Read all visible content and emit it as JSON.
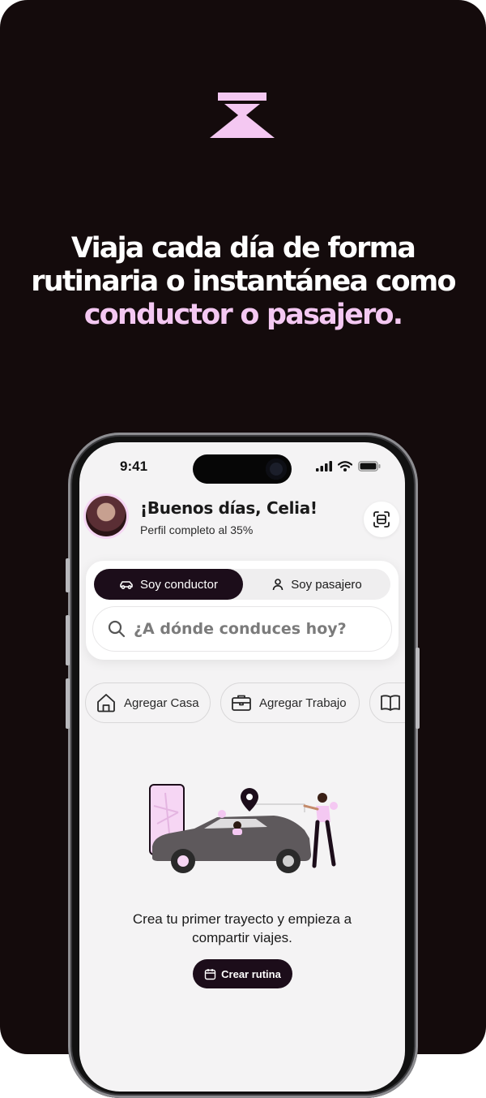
{
  "headline": {
    "line1": "Viaja cada día de forma",
    "line2": "rutinaria o instantánea como",
    "line3_highlight": "conductor o pasajero."
  },
  "status_bar": {
    "time": "9:41",
    "icons": [
      "signal-icon",
      "wifi-icon",
      "battery-icon"
    ]
  },
  "header": {
    "greeting": "¡Buenos días, Celia!",
    "profile_status": "Perfil completo al 35%"
  },
  "mode_toggle": {
    "options": [
      {
        "label": "Soy conductor",
        "icon": "car-icon",
        "selected": true
      },
      {
        "label": "Soy pasajero",
        "icon": "person-icon",
        "selected": false
      }
    ]
  },
  "search": {
    "placeholder": "¿A dónde conduces hoy?"
  },
  "quick_places": [
    {
      "label": "Agregar Casa",
      "icon": "home-icon"
    },
    {
      "label": "Agregar Trabajo",
      "icon": "briefcase-icon"
    },
    {
      "label": "",
      "icon": "book-icon"
    }
  ],
  "empty_state": {
    "message_line1": "Crea tu primer trayecto y empieza a",
    "message_line2": "compartir viajes.",
    "cta_label": "Crear rutina"
  },
  "colors": {
    "background": "#140b0c",
    "accent_pink": "#f4c8f2",
    "dark_button": "#1c0d1a",
    "screen_bg": "#f4f3f4"
  }
}
